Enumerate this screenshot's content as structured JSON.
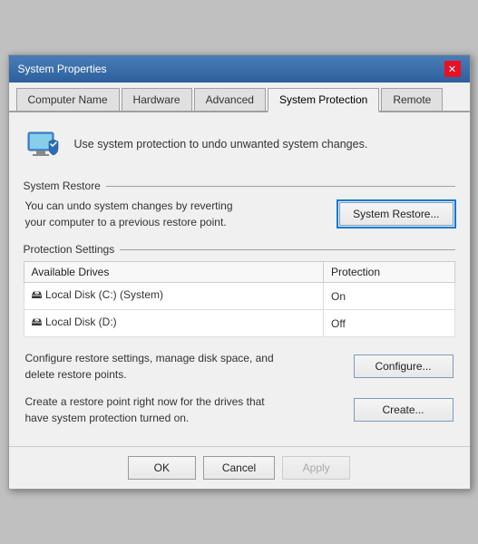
{
  "window": {
    "title": "System Properties",
    "close_label": "✕"
  },
  "tabs": [
    {
      "id": "computer-name",
      "label": "Computer Name",
      "active": false
    },
    {
      "id": "hardware",
      "label": "Hardware",
      "active": false
    },
    {
      "id": "advanced",
      "label": "Advanced",
      "active": false
    },
    {
      "id": "system-protection",
      "label": "System Protection",
      "active": true
    },
    {
      "id": "remote",
      "label": "Remote",
      "active": false
    }
  ],
  "header": {
    "text": "Use system protection to undo unwanted system changes."
  },
  "system_restore": {
    "section_label": "System Restore",
    "description": "You can undo system changes by reverting your computer to a previous restore point.",
    "button_label": "System Restore..."
  },
  "protection_settings": {
    "section_label": "Protection Settings",
    "columns": [
      "Available Drives",
      "Protection"
    ],
    "drives": [
      {
        "name": "Local Disk (C:) (System)",
        "protection": "On",
        "icon": "💽"
      },
      {
        "name": "Local Disk (D:)",
        "protection": "Off",
        "icon": "💽"
      }
    ]
  },
  "configure": {
    "description": "Configure restore settings, manage disk space, and delete restore points.",
    "button_label": "Configure..."
  },
  "create": {
    "description": "Create a restore point right now for the drives that have system protection turned on.",
    "button_label": "Create..."
  },
  "footer": {
    "ok_label": "OK",
    "cancel_label": "Cancel",
    "apply_label": "Apply"
  }
}
